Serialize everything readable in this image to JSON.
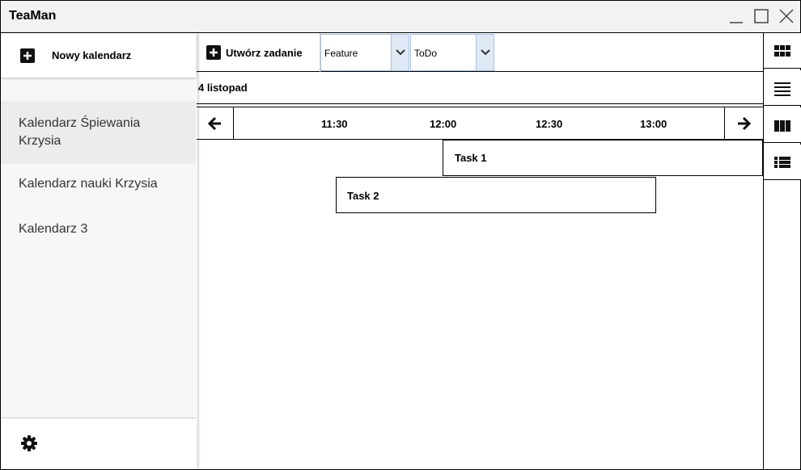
{
  "window": {
    "title": "TeaMan"
  },
  "sidebar": {
    "new_calendar_label": "Nowy kalendarz",
    "calendars": [
      {
        "label": "Kalendarz Śpiewania Krzysia",
        "active": true
      },
      {
        "label": "Kalendarz nauki Krzysia",
        "active": false
      },
      {
        "label": "Kalendarz 3",
        "active": false
      }
    ],
    "settings_icon": "gear-icon"
  },
  "toolbar": {
    "create_task_label": "Utwórz zadanie",
    "type_select": {
      "value": "Feature"
    },
    "status_select": {
      "value": "ToDo"
    }
  },
  "date_header": {
    "label": "4 listopad"
  },
  "timeline": {
    "prev_icon": "arrow-left-icon",
    "next_icon": "arrow-right-icon",
    "times": [
      "11:30",
      "12:00",
      "12:30",
      "13:00"
    ]
  },
  "tasks": [
    {
      "label": "Task 1"
    },
    {
      "label": "Task 2"
    }
  ],
  "view_switcher": [
    {
      "icon": "grid-view-icon"
    },
    {
      "icon": "list-view-icon"
    },
    {
      "icon": "columns-view-icon"
    },
    {
      "icon": "detailed-list-view-icon"
    }
  ],
  "colors": {
    "titlebar_bg": "#f2f2f2",
    "select_border": "#a7c2e6",
    "select_caret_bg": "#dfe8f5"
  }
}
